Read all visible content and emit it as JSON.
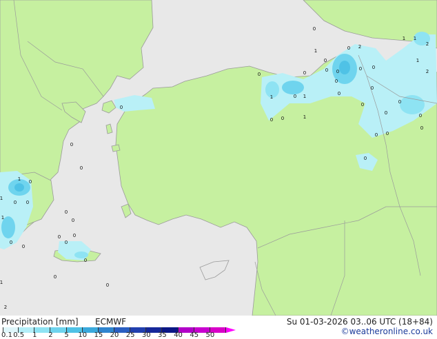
{
  "footer": {
    "title": "Precipitation [mm]",
    "model": "ECMWF",
    "valid_time": "Su 01-03-2026 03..06 UTC (18+84)",
    "credit": "©weatheronline.co.uk"
  },
  "legend": {
    "ticks": [
      "0.1",
      "0.5",
      "1",
      "2",
      "5",
      "10",
      "15",
      "20",
      "25",
      "30",
      "35",
      "40",
      "45",
      "50"
    ],
    "colors": [
      "#dff7fb",
      "#b3eef8",
      "#8ee3f3",
      "#6fd4ee",
      "#4fc2e6",
      "#3aa9dc",
      "#2f85cf",
      "#2a5fc2",
      "#213fae",
      "#16289a",
      "#0b1785",
      "#b100c8",
      "#c800d0",
      "#d800c8"
    ],
    "arrow_color": "#ff00ff"
  },
  "map": {
    "sea_color": "#e8e8e8",
    "land_color": "#c6f0a0",
    "border_color": "#9a9a9a",
    "precip_labels": [
      "0",
      "1",
      "0",
      "2",
      "0",
      "0",
      "0",
      "0",
      "0",
      "0",
      "0",
      "1",
      "0",
      "1",
      "0",
      "1",
      "0",
      "0",
      "0",
      "0",
      "0",
      "0",
      "0",
      "1",
      "1",
      "2",
      "1",
      "2",
      "0",
      "0",
      "0",
      "0",
      "0",
      "0",
      "0",
      "0",
      "0",
      "1",
      "0",
      "0",
      "0",
      "1",
      "2",
      "0",
      "0",
      "0",
      "1",
      "1",
      "0",
      "0",
      "0",
      "0",
      "0",
      "0"
    ]
  }
}
